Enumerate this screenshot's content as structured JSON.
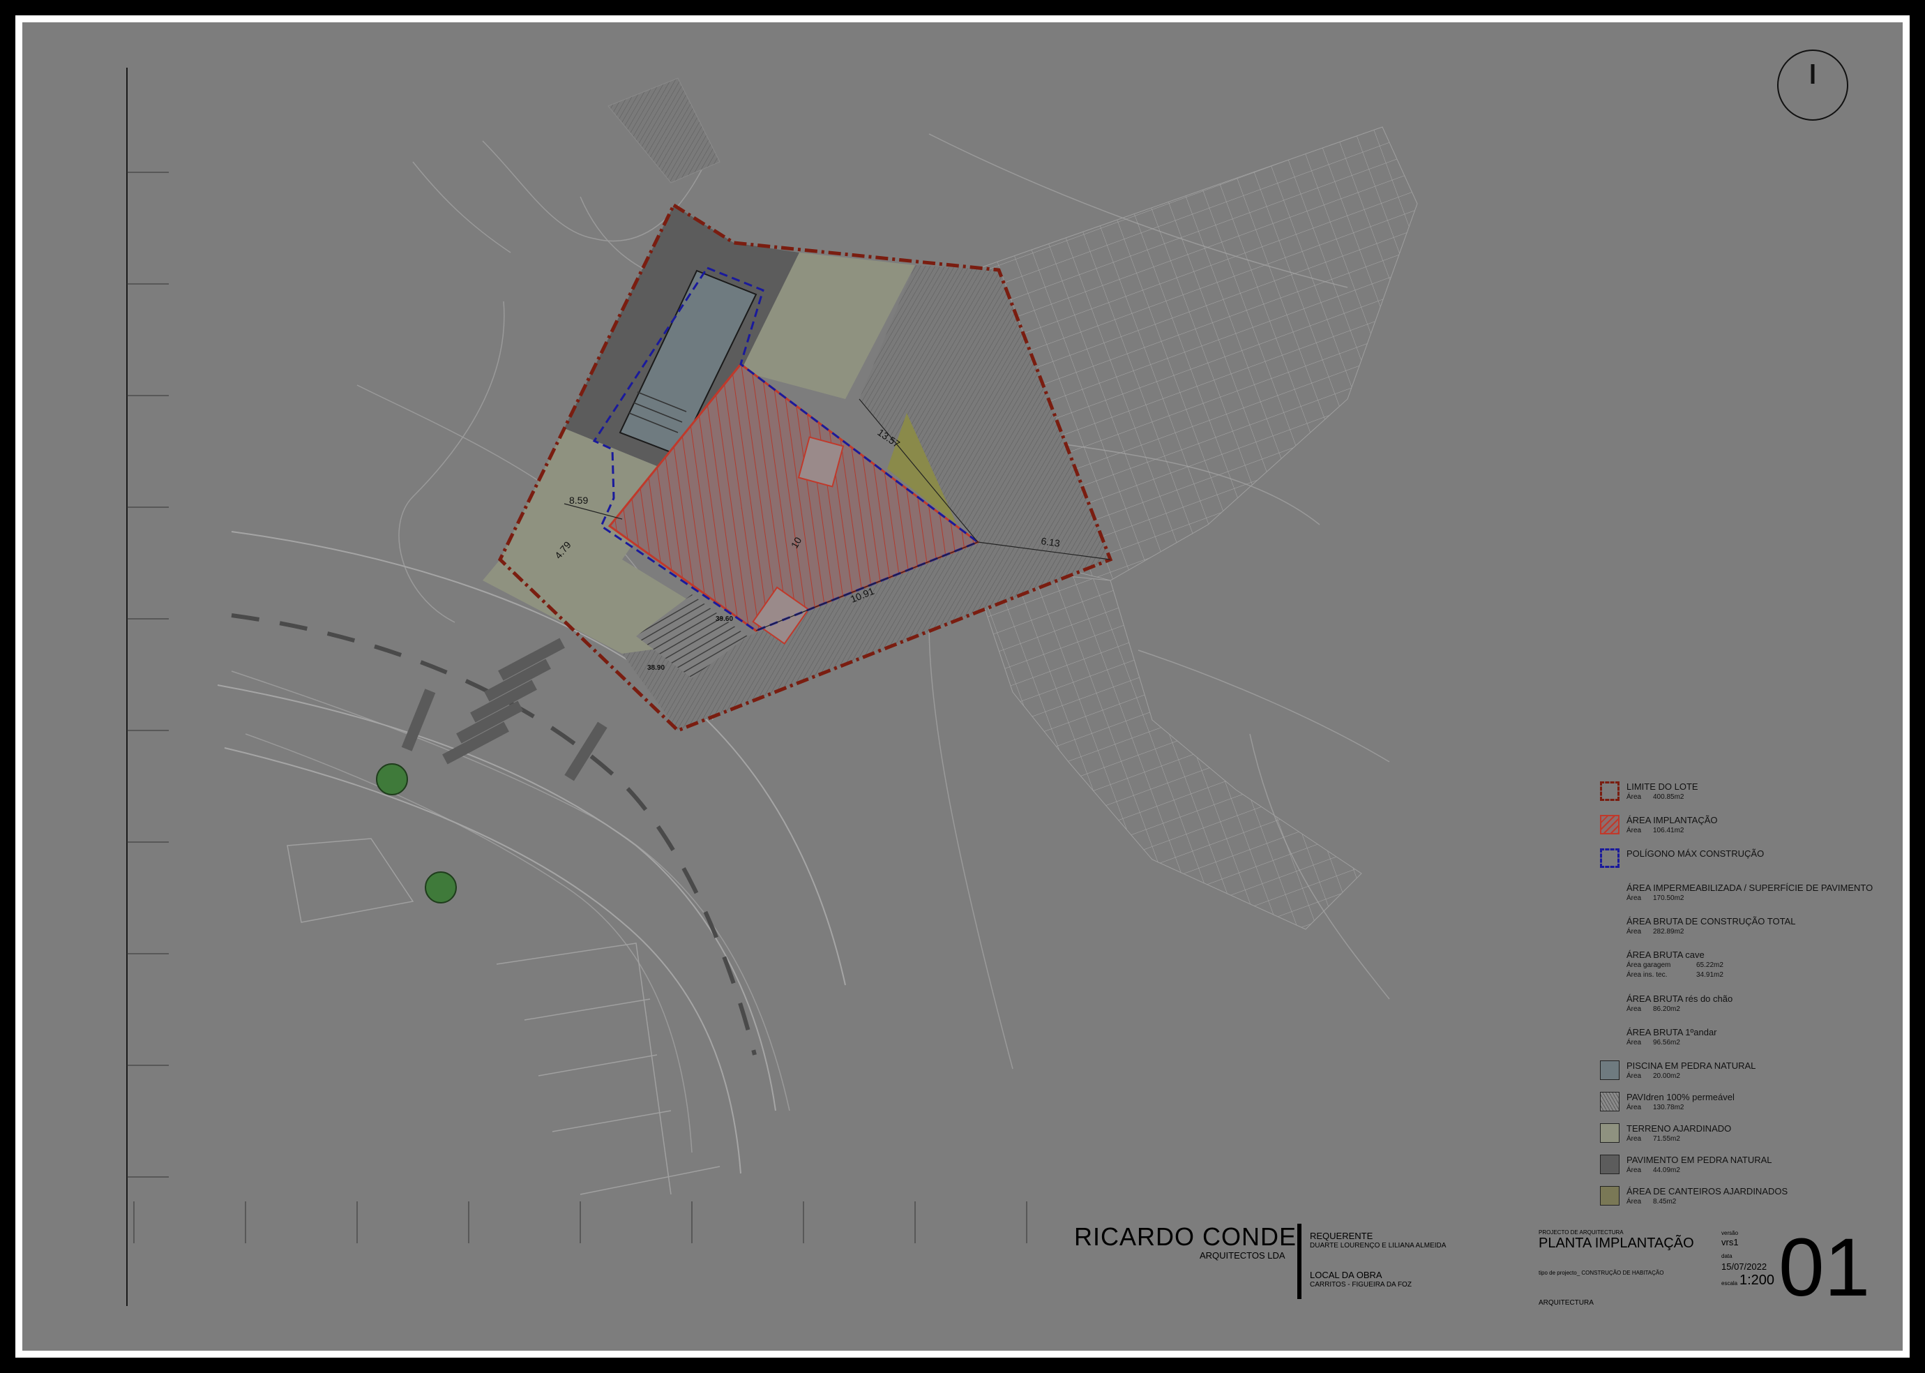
{
  "title_block": {
    "firm_name": "RICARDO CONDE",
    "firm_subtitle": "ARQUITECTOS LDA",
    "requerente_label": "REQUERENTE",
    "requerente_value": "DUARTE LOURENÇO E LILIANA ALMEIDA",
    "local_label": "LOCAL DA OBRA",
    "local_value": "CARRITOS - FIGUEIRA DA FOZ",
    "project_type_label": "PROJECTO DE ARQUITECTURA",
    "drawing_title": "PLANTA IMPLANTAÇÃO",
    "tipo_projecto": "tipo de projecto_ CONSTRUÇÃO DE HABITAÇÃO",
    "speciality": "ARQUITECTURA",
    "versao_label": "versão",
    "versao_value": "vrs1",
    "data_label": "data",
    "data_value": "15/07/2022",
    "escala_label": "escala",
    "escala_value": "1:200",
    "sheet_number": "01"
  },
  "legend": {
    "area_label": "Área",
    "limite": {
      "title": "LIMITE DO LOTE",
      "value": "400.85m2"
    },
    "implantacao": {
      "title": "ÁREA IMPLANTAÇÃO",
      "value": "106.41m2"
    },
    "poligono": {
      "title": "POLÍGONO MÁX CONSTRUÇÃO"
    },
    "impermeabilizada": {
      "title": "ÁREA IMPERMEABILIZADA / SUPERFÍCIE DE PAVIMENTO",
      "value": "170.50m2"
    },
    "bruta_total": {
      "title": "ÁREA BRUTA DE CONSTRUÇÃO TOTAL",
      "value": "282.89m2"
    },
    "bruta_cave": {
      "title": "ÁREA BRUTA cave",
      "garagem_label": "Área  garagem",
      "garagem_value": "65.22m2",
      "instec_label": "Área  ins. tec.",
      "instec_value": "34.91m2"
    },
    "bruta_res": {
      "title": "ÁREA BRUTA rés do chão",
      "value": "86.20m2"
    },
    "bruta_1andar": {
      "title": "ÁREA BRUTA 1ºandar",
      "value": "96.56m2"
    },
    "piscina": {
      "title": "PISCINA EM PEDRA NATURAL",
      "value": "20.00m2",
      "color": "#6f7b80"
    },
    "pavidren": {
      "title": "PAVIdren 100% permeável",
      "value": "130.78m2",
      "color": "#8a8a8a"
    },
    "terreno": {
      "title": "TERRENO AJARDINADO",
      "value": "71.55m2",
      "color": "#8f9280"
    },
    "pavimento": {
      "title": "PAVIMENTO EM PEDRA NATURAL",
      "value": "44.09m2",
      "color": "#5c5c5c"
    },
    "canteiros": {
      "title": "ÁREA DE CANTEIROS AJARDINADOS",
      "value": "8.45m2",
      "color": "#7a7856"
    }
  },
  "plan_labels": {
    "dim_1": "6.13",
    "dim_2": "10.91",
    "dim_3": "8.59",
    "dim_4": "4.79",
    "dim_5": "13.57",
    "dim_6": "10",
    "level_1": "39.60",
    "level_2": "38.90"
  },
  "colors": {
    "lot_boundary": "#7a1d10",
    "implantation": "#c0392b",
    "max_polygon": "#1a1a9c"
  }
}
